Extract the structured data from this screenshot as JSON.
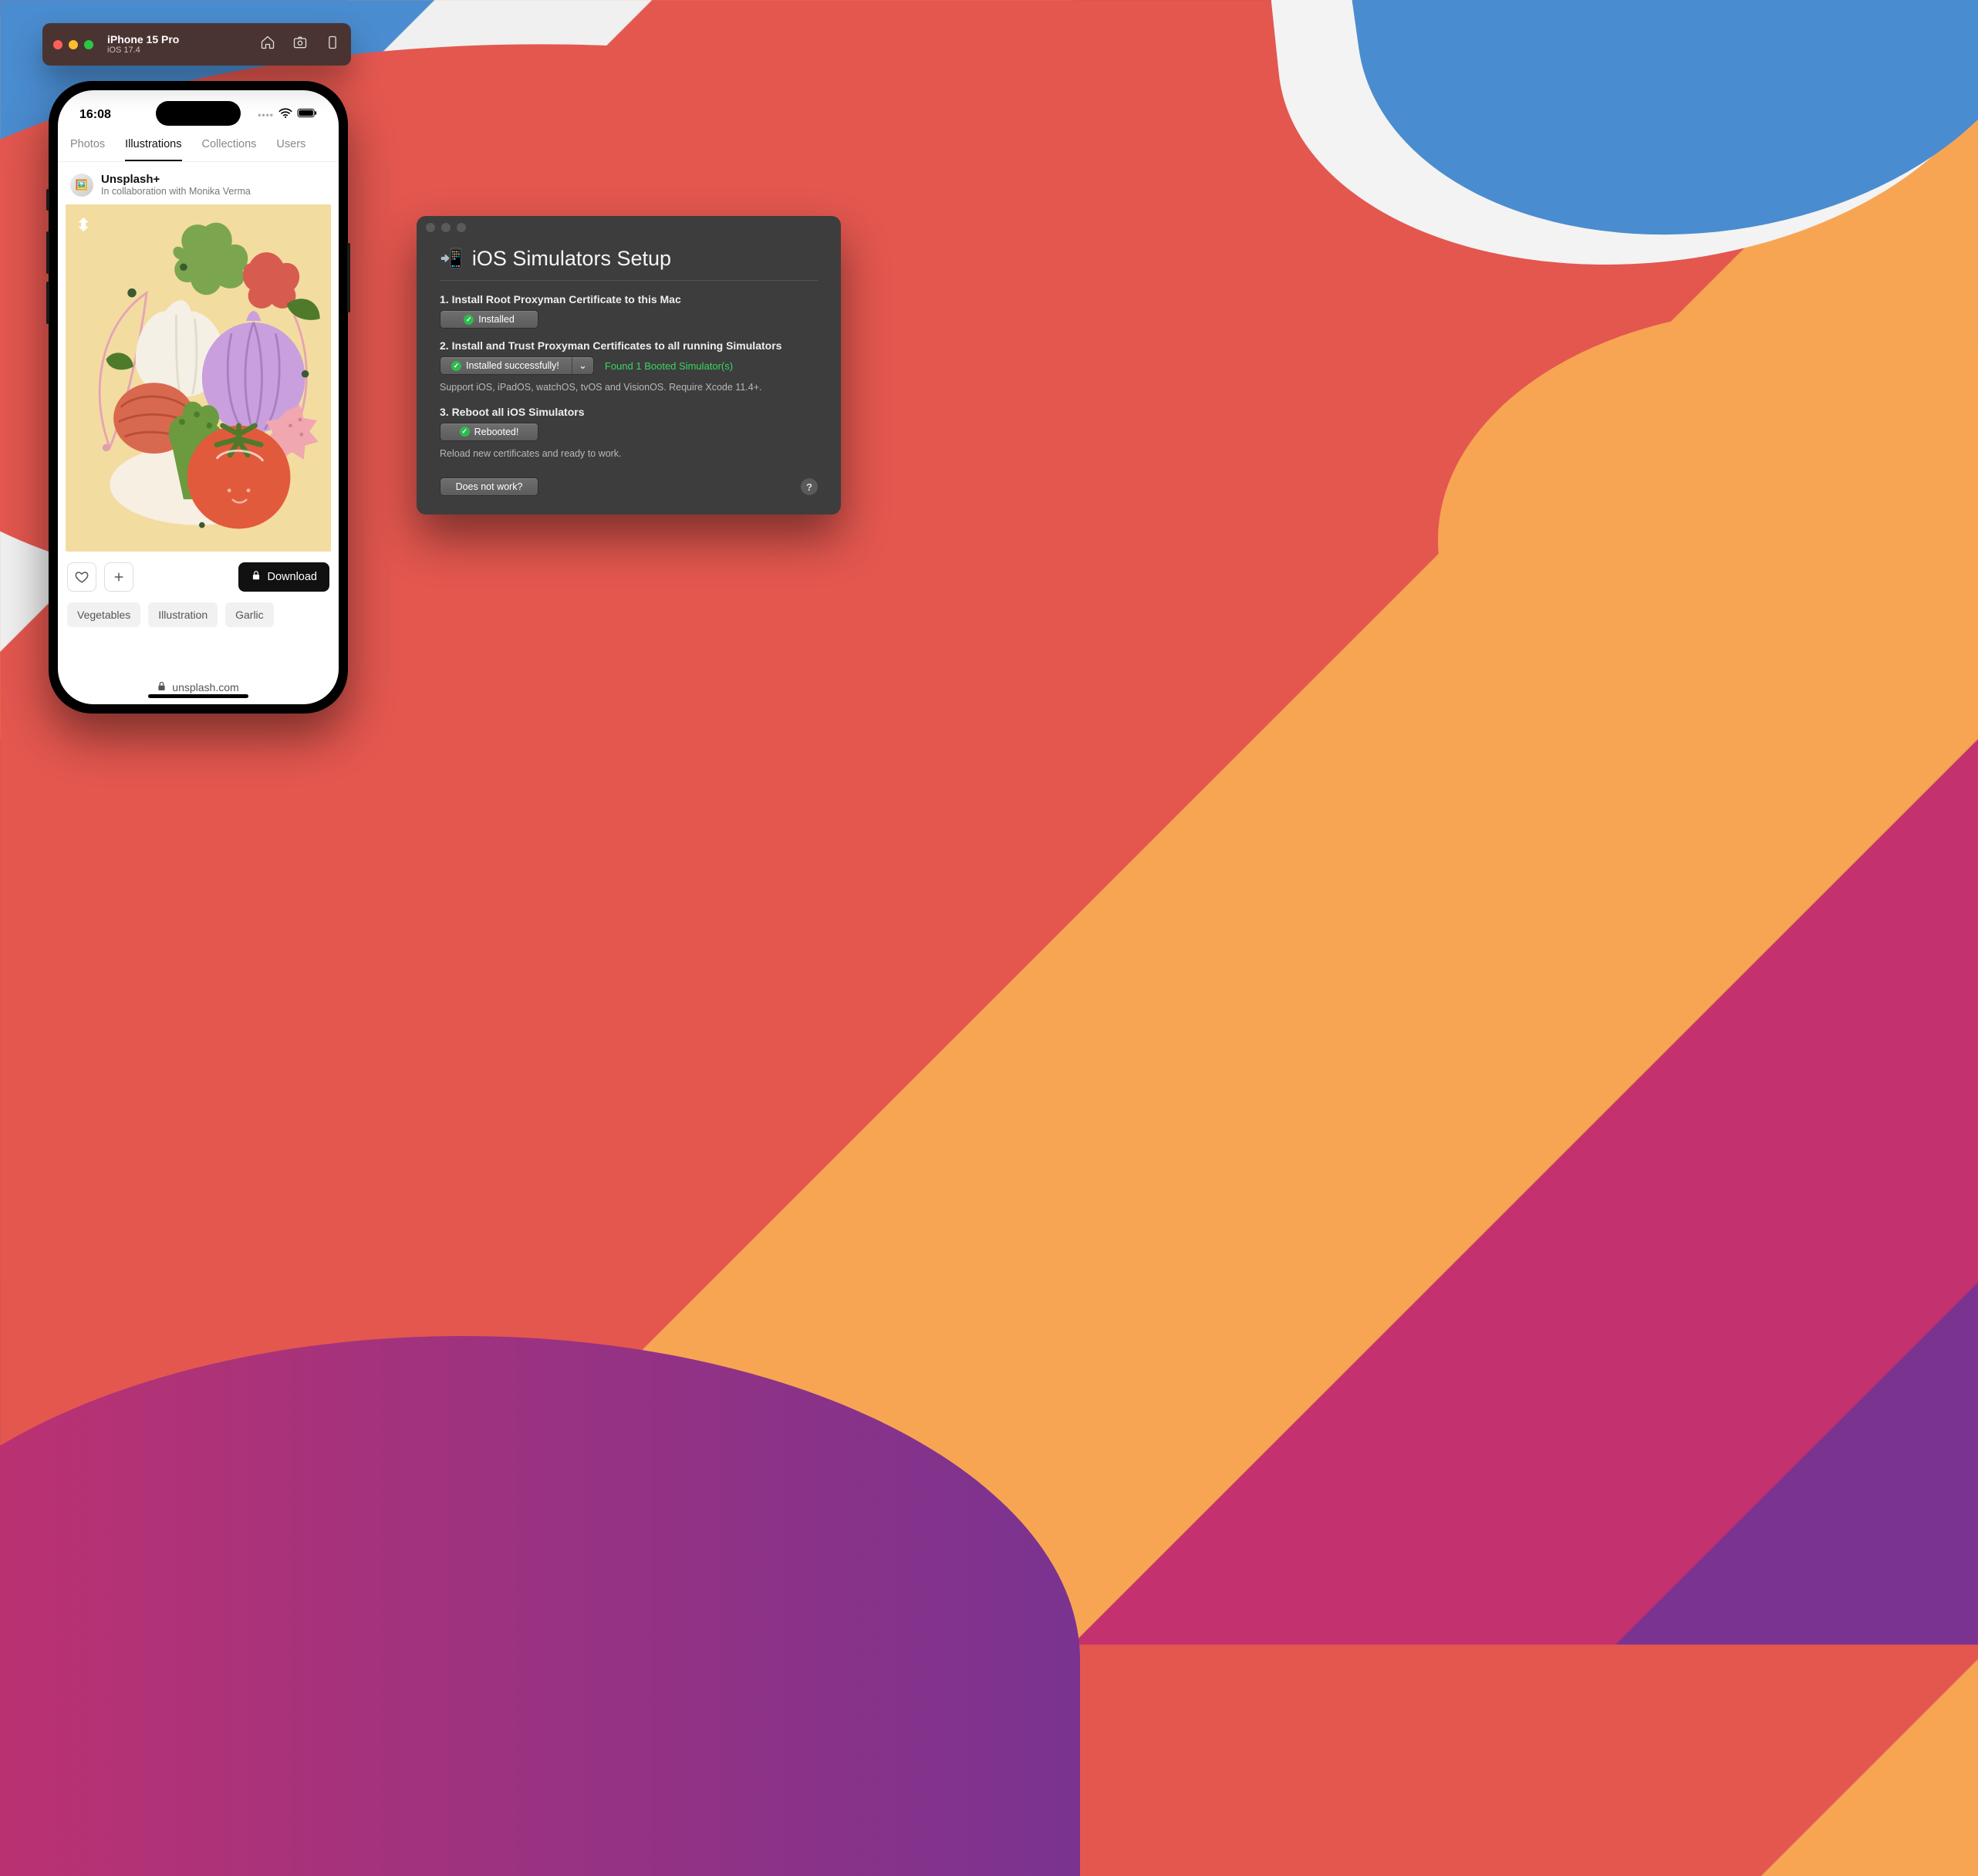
{
  "simulator_bar": {
    "device": "iPhone 15 Pro",
    "os": "iOS 17.4"
  },
  "phone": {
    "time": "16:08",
    "tabs": [
      "Photos",
      "Illustrations",
      "Collections",
      "Users"
    ],
    "active_tab_index": 1,
    "author": {
      "name": "Unsplash+",
      "collab": "In collaboration with Monika Verma"
    },
    "watermark": "⬍",
    "download_label": "Download",
    "tags": [
      "Vegetables",
      "Illustration",
      "Garlic"
    ],
    "url": "unsplash.com"
  },
  "proxyman": {
    "title": "iOS Simulators Setup",
    "steps": {
      "s1": {
        "label": "1. Install Root Proxyman Certificate to this Mac",
        "status": "Installed"
      },
      "s2": {
        "label": "2. Install and Trust Proxyman Certificates to all running Simulators",
        "status": "Installed successfully!",
        "found": "Found 1 Booted Simulator(s)",
        "note": "Support iOS, iPadOS, watchOS, tvOS and VisionOS. Require Xcode 11.4+."
      },
      "s3": {
        "label": "3. Reboot all iOS Simulators",
        "status": "Rebooted!",
        "note": "Reload new certificates and ready to work."
      }
    },
    "not_work": "Does not work?",
    "help": "?"
  }
}
